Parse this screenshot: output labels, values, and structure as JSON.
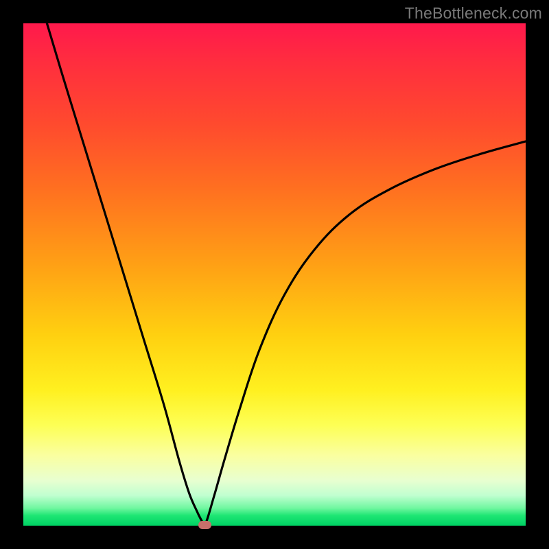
{
  "watermark": "TheBottleneck.com",
  "colors": {
    "frame": "#000000",
    "curve": "#000000",
    "marker": "#c76f6a",
    "gradient_top": "#ff194c",
    "gradient_bottom": "#00d264"
  },
  "chart_data": {
    "type": "line",
    "title": "",
    "xlabel": "",
    "ylabel": "",
    "xlim": [
      0,
      1
    ],
    "ylim": [
      0,
      1
    ],
    "annotations": [
      "TheBottleneck.com"
    ],
    "series": [
      {
        "name": "left-branch",
        "x": [
          0.047,
          0.08,
          0.12,
          0.16,
          0.2,
          0.24,
          0.28,
          0.31,
          0.33,
          0.345,
          0.355,
          0.362
        ],
        "y": [
          1.0,
          0.89,
          0.76,
          0.63,
          0.5,
          0.37,
          0.24,
          0.13,
          0.065,
          0.03,
          0.01,
          0.002
        ]
      },
      {
        "name": "right-branch",
        "x": [
          0.362,
          0.38,
          0.4,
          0.43,
          0.47,
          0.52,
          0.58,
          0.65,
          0.73,
          0.82,
          0.91,
          1.0
        ],
        "y": [
          0.002,
          0.06,
          0.13,
          0.23,
          0.35,
          0.46,
          0.55,
          0.62,
          0.67,
          0.71,
          0.74,
          0.765
        ]
      }
    ],
    "marker": {
      "x": 0.362,
      "y": 0.002
    }
  }
}
